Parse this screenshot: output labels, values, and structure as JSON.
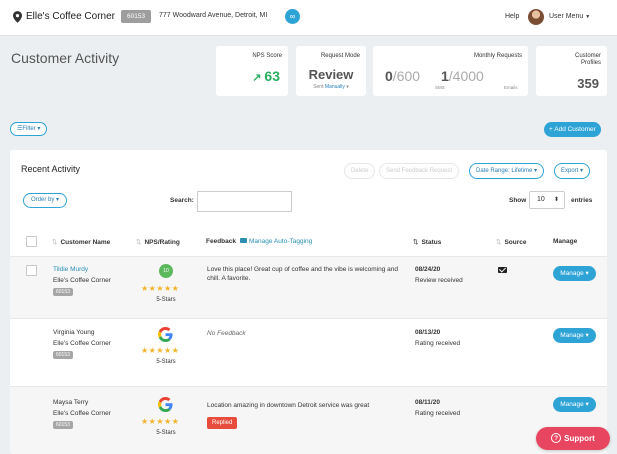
{
  "header": {
    "location_name": "Elle's Coffee Corner",
    "location_id": "60153",
    "address": "777 Woodward Avenue, Detroit, MI",
    "link_icon": "link-icon",
    "help": "Help",
    "user_menu": "User Menu"
  },
  "page": {
    "title": "Customer Activity"
  },
  "stats": {
    "nps": {
      "label": "NPS Score",
      "value": "63",
      "trend_icon": "trend-up-icon",
      "color": "#27ae60"
    },
    "request_mode": {
      "label": "Request Mode",
      "value": "Review",
      "sent_prefix": "Sent",
      "sent_value": "Manually"
    },
    "monthly": {
      "label": "Monthly Requests",
      "sms_used": "0",
      "sms_limit": "/600",
      "sms_label": "SMS",
      "email_used": "1",
      "email_limit": "/4000",
      "email_label": "Emails"
    },
    "profiles": {
      "label_line1": "Customer",
      "label_line2": "Profiles",
      "value": "359"
    }
  },
  "toolbar": {
    "filter": "Filter",
    "add_customer": "+ Add Customer"
  },
  "recent": {
    "title": "Recent Activity",
    "delete": "Delete",
    "send_feedback": "Send Feedback Request",
    "date_range": "Date Range: Lifetime",
    "export": "Export",
    "order_by": "Order by",
    "search_label": "Search:",
    "search_value": "",
    "show_label": "Show",
    "show_value": "10",
    "entries_label": "entries",
    "columns": {
      "customer_name": "Customer Name",
      "nps_rating": "NPS/Rating",
      "feedback": "Feedback",
      "manage_auto_tagging": "Manage Auto-Tagging",
      "status": "Status",
      "source": "Source",
      "manage": "Manage"
    },
    "rows": [
      {
        "name": "Tildie Murdy",
        "business": "Elle's Coffee Corner",
        "business_id": "60153",
        "nps_score": "10",
        "stars": "★★★★★",
        "stars_label": "5-Stars",
        "feedback": "Love this place! Great cup of coffee and the vibe is welcoming and chill. A favorite.",
        "date": "08/24/20",
        "status": "Review received",
        "source_icon": "email-icon",
        "manage": "Manage"
      },
      {
        "name": "Virginia Young",
        "business": "Elle's Coffee Corner",
        "business_id": "60153",
        "source_logo": "google-icon",
        "stars": "★★★★★",
        "stars_label": "5-Stars",
        "feedback": "No Feedback",
        "date": "08/13/20",
        "status": "Rating received",
        "manage": "Manage"
      },
      {
        "name": "Maysa Terry",
        "business": "Elle's Coffee Corner",
        "business_id": "60153",
        "source_logo": "google-icon",
        "stars": "★★★★★",
        "stars_label": "5-Stars",
        "feedback": "Location amazing in downtown Detroit service was great",
        "reply_badge": "Replied",
        "date": "08/11/20",
        "status": "Rating received",
        "manage": "Manage"
      }
    ]
  },
  "support": {
    "label": "Support"
  },
  "colors": {
    "accent": "#2ea3d6",
    "nps_green": "#27ae60",
    "support_red": "#e84560",
    "replied_red": "#e74c3c",
    "star_gold": "#f0b429"
  }
}
